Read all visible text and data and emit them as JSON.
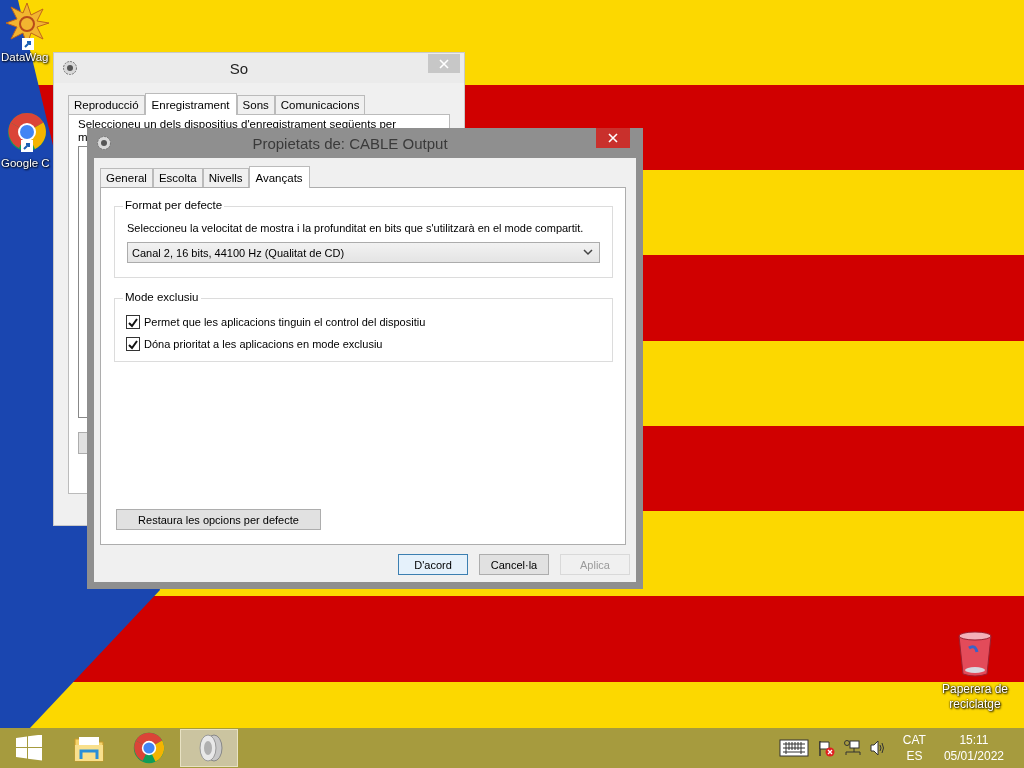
{
  "desktop": {
    "icons": [
      {
        "label": "DataWag",
        "kind": "sunburst"
      },
      {
        "label": "Google C",
        "kind": "chrome"
      },
      {
        "label": "Paperera de reciclatge",
        "kind": "bin"
      }
    ]
  },
  "sound_window": {
    "title": "So",
    "tabs": [
      {
        "label": "Reproducció",
        "selected": false
      },
      {
        "label": "Enregistrament",
        "selected": true
      },
      {
        "label": "Sons",
        "selected": false
      },
      {
        "label": "Comunicacions",
        "selected": false
      }
    ],
    "instruction": "Seleccioneu un dels dispositius d'enregistrament següents per",
    "instruction_cut": "m"
  },
  "properties_dialog": {
    "title": "Propietats de: CABLE Output",
    "tabs": [
      {
        "label": "General",
        "selected": false
      },
      {
        "label": "Escolta",
        "selected": false
      },
      {
        "label": "Nivells",
        "selected": false
      },
      {
        "label": "Avançats",
        "selected": true
      }
    ],
    "default_format": {
      "legend": "Format per defecte",
      "description": "Seleccioneu la velocitat de mostra i la profunditat en bits que s'utilitzarà en el mode compartit.",
      "dropdown": {
        "value": "Canal 2, 16 bits, 44100 Hz (Qualitat de CD)"
      }
    },
    "exclusive_mode": {
      "legend": "Mode exclusiu",
      "options": [
        {
          "label": "Permet que les aplicacions tinguin el control del dispositiu",
          "checked": true
        },
        {
          "label": "Dóna prioritat a les aplicacions en mode exclusiu",
          "checked": true
        }
      ]
    },
    "restore_button": "Restaura les opcions per defecte",
    "buttons": [
      {
        "label": "D'acord",
        "kind": "default"
      },
      {
        "label": "Cancel·la",
        "kind": "normal"
      },
      {
        "label": "Aplica",
        "kind": "disabled"
      }
    ]
  },
  "taskbar": {
    "apps": [
      {
        "kind": "start",
        "selected": false
      },
      {
        "kind": "explorer",
        "selected": false
      },
      {
        "kind": "chrome",
        "selected": false
      },
      {
        "kind": "sound",
        "selected": true
      }
    ],
    "language": "CAT",
    "layout": "ES",
    "time": "15:11",
    "date": "05/01/2022"
  }
}
